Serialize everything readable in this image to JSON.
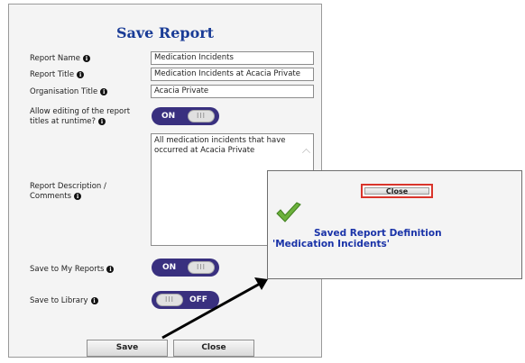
{
  "dialog": {
    "title": "Save Report",
    "report_name_label": "Report Name",
    "report_name_value": "Medication Incidents",
    "report_title_label": "Report Title",
    "report_title_value": "Medication Incidents at Acacia Private",
    "org_title_label": "Organisation Title",
    "org_title_value": "Acacia Private",
    "allow_edit_label_1": "Allow editing of the report",
    "allow_edit_label_2": "titles at runtime?",
    "allow_edit_toggle": {
      "state": "ON",
      "knob": "III"
    },
    "description_label_1": "Report Description /",
    "description_label_2": "Comments",
    "description_value": "All medication incidents that have occurred at Acacia Private",
    "save_my_reports_label": "Save to My Reports",
    "save_my_reports_toggle": {
      "state": "ON",
      "knob": "III"
    },
    "save_library_label": "Save to Library",
    "save_library_toggle": {
      "state": "OFF",
      "knob": "III"
    },
    "save_button": "Save",
    "close_button": "Close"
  },
  "popup": {
    "close_button": "Close",
    "message_line1": "Saved Report Definition",
    "message_line2": "'Medication Incidents'"
  },
  "colors": {
    "accent": "#39307f",
    "title_blue": "#1a3c96",
    "highlight_red": "#d9342b",
    "check_green": "#6cb13c"
  }
}
